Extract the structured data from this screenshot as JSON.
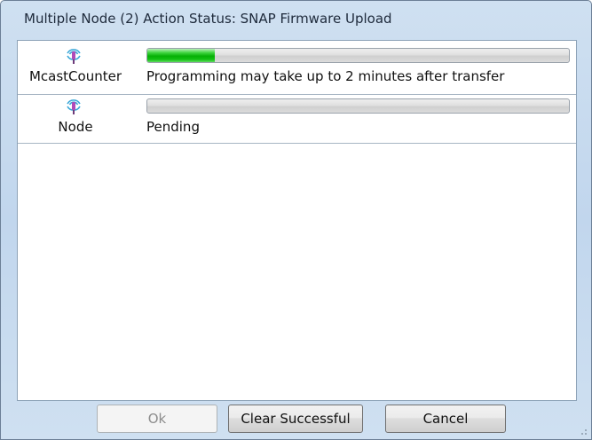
{
  "window": {
    "title": "Multiple Node (2) Action Status: SNAP Firmware Upload"
  },
  "nodes": [
    {
      "name": "McastCounter",
      "icon": "wireless-node-icon",
      "progress": 0.16,
      "status": "Programming may take up to 2 minutes after transfer"
    },
    {
      "name": "Node",
      "icon": "wireless-node-icon",
      "progress": 0,
      "status": "Pending"
    }
  ],
  "buttons": {
    "ok_label": "Ok",
    "clear_label": "Clear Successful",
    "cancel_label": "Cancel"
  },
  "colors": {
    "progress_fill": "#06b006",
    "window_frame": "#c1d6ed"
  }
}
